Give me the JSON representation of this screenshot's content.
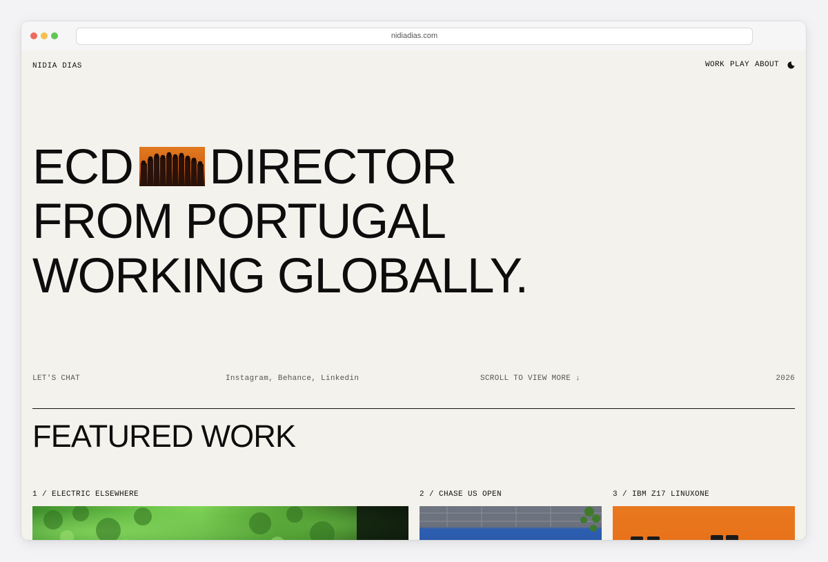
{
  "browser": {
    "url": "nidiadias.com"
  },
  "header": {
    "brand": "NIDIA DIAS",
    "nav": [
      {
        "label": "WORK"
      },
      {
        "label": "PLAY"
      },
      {
        "label": "ABOUT"
      }
    ],
    "theme_icon": "moon-icon"
  },
  "hero": {
    "line1_before": "ECD",
    "line1_after": "DIRECTOR",
    "line2": "FROM PORTUGAL",
    "line3": "WORKING GLOBALLY."
  },
  "info": {
    "chat": "LET'S CHAT",
    "social": "Instagram, Behance, Linkedin",
    "scroll": "SCROLL TO VIEW MORE ↓",
    "year": "2026"
  },
  "featured": {
    "title": "FEATURED WORK",
    "items": [
      {
        "label": "1 / ELECTRIC ELSEWHERE"
      },
      {
        "label": "2 / CHASE US OPEN"
      },
      {
        "label": "3 / IBM Z17 LINUXONE"
      }
    ]
  },
  "colors": {
    "page_bg": "#f4f2ec",
    "text": "#111111",
    "accent_orange": "#e8781f"
  }
}
